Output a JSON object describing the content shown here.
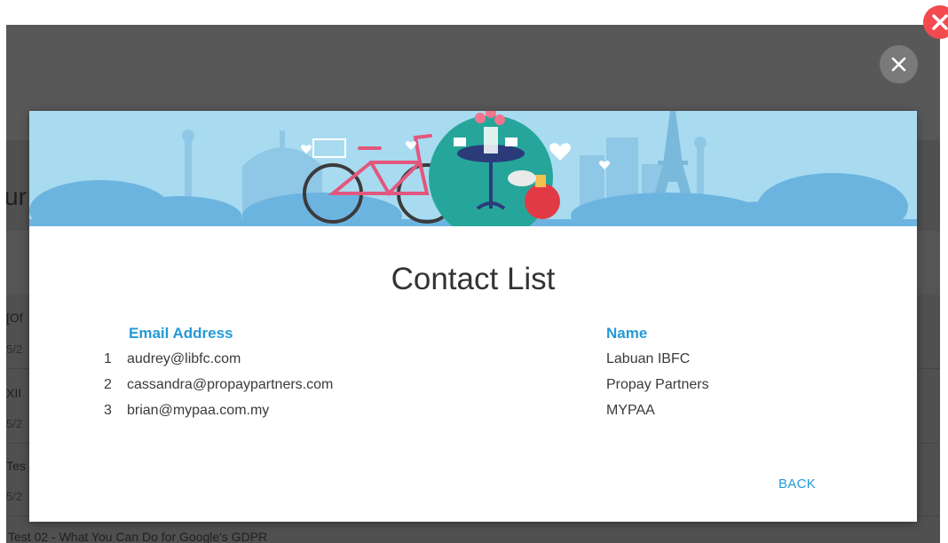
{
  "background": {
    "fragments": [
      {
        "text": "ur"
      },
      {
        "text": "[Of"
      },
      {
        "text": "5/2"
      },
      {
        "text": "XII"
      },
      {
        "text": "5/2"
      },
      {
        "text": "Tes"
      },
      {
        "text": "5/2"
      }
    ],
    "bottom_text": "Test 02 - What You Can Do for Google's GDPR"
  },
  "modal": {
    "title": "Contact List",
    "columns": {
      "email": "Email Address",
      "name": "Name"
    },
    "contacts": [
      {
        "num": "1",
        "email": "audrey@libfc.com",
        "name": "Labuan IBFC"
      },
      {
        "num": "2",
        "email": "cassandra@propaypartners.com",
        "name": "Propay Partners"
      },
      {
        "num": "3",
        "email": "brian@mypaa.com.my",
        "name": "MYPAA"
      }
    ],
    "back_label": "BACK"
  },
  "colors": {
    "accent": "#2499d8",
    "close_red": "#f24a4f",
    "banner_sky": "#a8dbf0",
    "banner_teal": "#26a69a"
  }
}
